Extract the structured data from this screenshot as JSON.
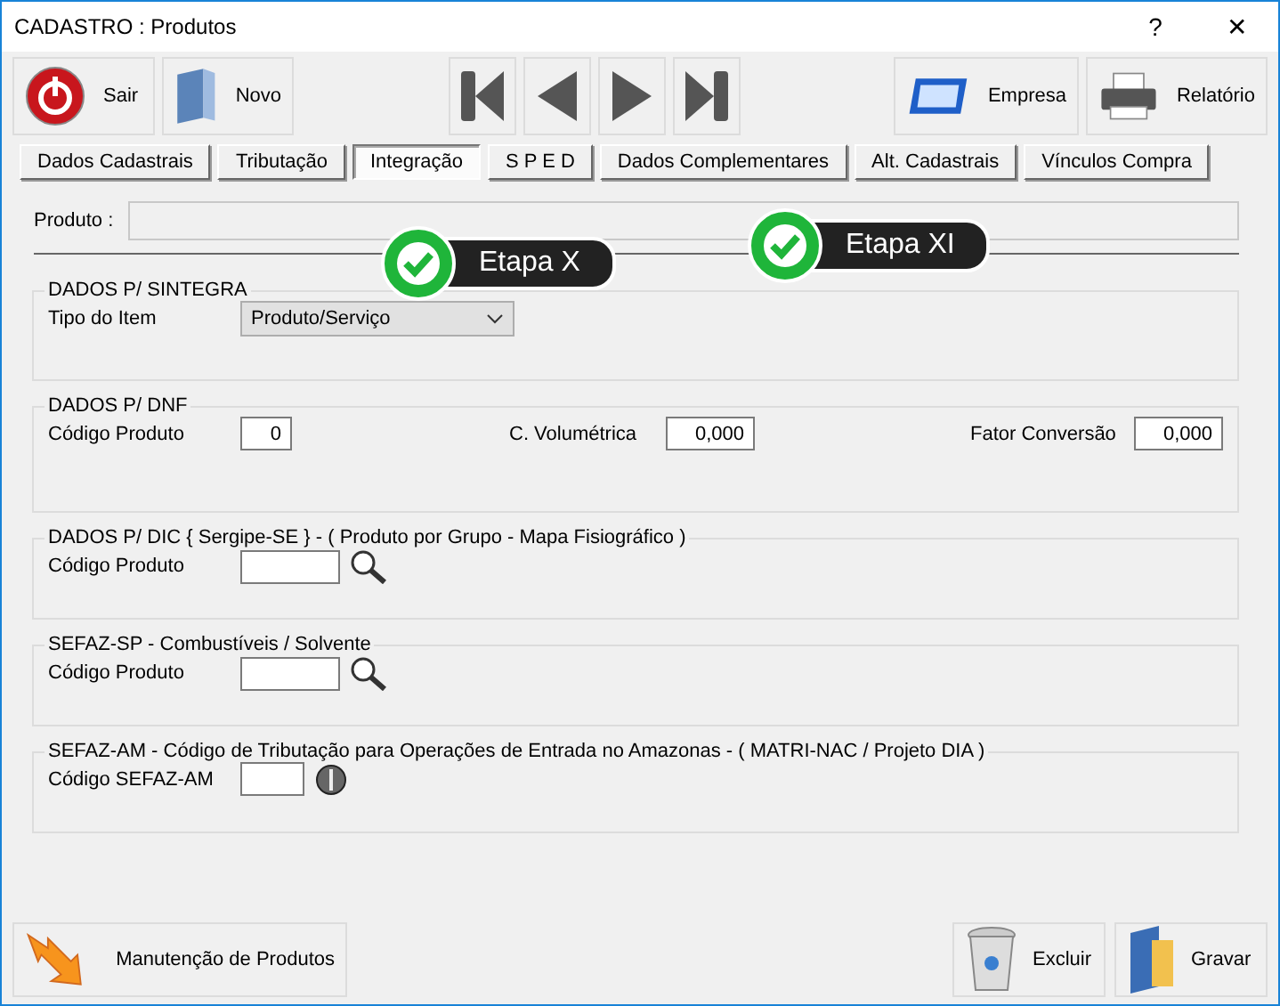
{
  "window": {
    "title": "CADASTRO : Produtos",
    "controls": [
      "?",
      "✕"
    ]
  },
  "toolbar": {
    "left": [
      {
        "kind": "power",
        "label": "Sair"
      },
      {
        "kind": "book",
        "label": "Novo"
      }
    ],
    "nav": [
      {
        "kind": "first"
      },
      {
        "kind": "prev"
      },
      {
        "kind": "next"
      },
      {
        "kind": "last"
      }
    ],
    "right": [
      {
        "kind": "card",
        "label": "Empresa"
      },
      {
        "kind": "printer",
        "label": "Relatório"
      }
    ]
  },
  "tabs": [
    {
      "label": "Dados Cadastrais",
      "selected": false
    },
    {
      "label": "Tributação",
      "selected": false
    },
    {
      "label": "Integração",
      "selected": true
    },
    {
      "label": "S P E D",
      "selected": false
    },
    {
      "label": "Dados Complementares",
      "selected": false
    },
    {
      "label": "Alt. Cadastrais",
      "selected": false
    },
    {
      "label": "Vínculos Compra",
      "selected": false
    }
  ],
  "product": {
    "label": "Produto :"
  },
  "callouts": [
    "Etapa X",
    "Etapa XI"
  ],
  "groups": [
    {
      "title": "DADOS P/ SINTEGRA",
      "fields": [
        {
          "kind": "select",
          "label": "Tipo do Item",
          "value": "Produto/Serviço"
        }
      ]
    },
    {
      "title": "DADOS P/ DNF",
      "fields": [
        {
          "kind": "number",
          "label": "Código Produto",
          "value": "0"
        },
        {
          "kind": "number",
          "label": "C. Volumétrica",
          "value": "0,000"
        },
        {
          "kind": "number",
          "label": "Fator Conversão",
          "value": "0,000"
        }
      ]
    },
    {
      "title": "DADOS P/ DIC  { Sergipe-SE }  -   ( Produto por Grupo - Mapa Fisiográfico )",
      "fields": [
        {
          "kind": "search",
          "label": "Código Produto"
        }
      ]
    },
    {
      "title": "SEFAZ-SP - Combustíveis / Solvente",
      "fields": [
        {
          "kind": "search",
          "label": "Código Produto"
        }
      ]
    },
    {
      "title": "SEFAZ-AM - Código de Tributação para Operações de Entrada no Amazonas - ( MATRI-NAC / Projeto DIA )",
      "fields": [
        {
          "kind": "ball",
          "label": "Código SEFAZ-AM"
        }
      ]
    }
  ],
  "footer": {
    "left": [
      {
        "kind": "arrow",
        "label": "Manutenção de Produtos"
      }
    ],
    "right": [
      {
        "kind": "trash",
        "label": "Excluir"
      },
      {
        "kind": "folder",
        "label": "Gravar"
      }
    ]
  }
}
